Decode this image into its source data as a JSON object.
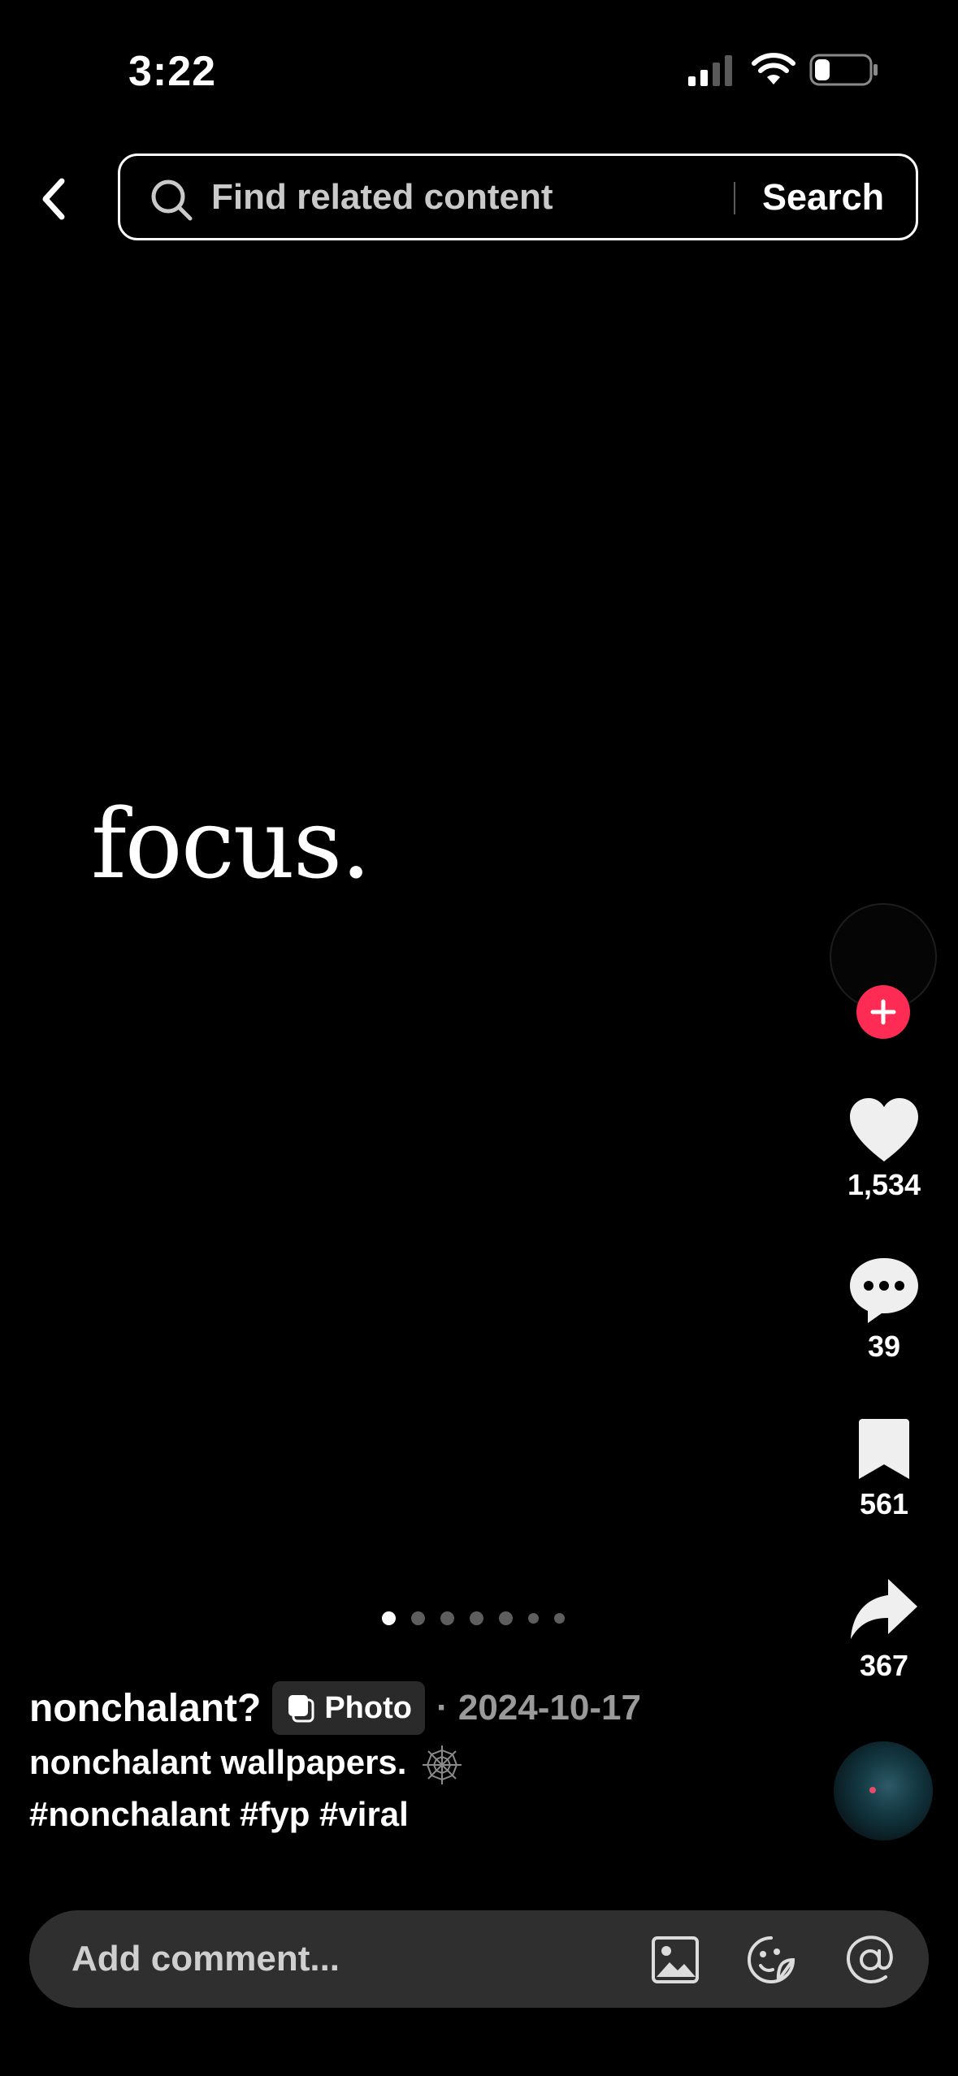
{
  "status_bar": {
    "time": "3:22",
    "icons": [
      "cell-signal-icon",
      "wifi-icon",
      "battery-icon"
    ]
  },
  "search": {
    "placeholder": "Find related content",
    "button_label": "Search",
    "icons": [
      "back-chevron-icon",
      "search-icon"
    ]
  },
  "photo": {
    "text": "focus.",
    "slide_count": 7,
    "active_slide": 1
  },
  "actions": {
    "likes": "1,534",
    "comments": "39",
    "bookmarks": "561",
    "shares": "367",
    "icons": [
      "heart-icon",
      "comment-bubble-icon",
      "bookmark-icon",
      "share-arrow-icon",
      "plus-icon"
    ]
  },
  "caption": {
    "author": "nonchalant?",
    "badge_label": "Photo",
    "date": "· 2024-10-17",
    "description": "nonchalant wallpapers.",
    "hashtags": "#nonchalant #fyp #viral"
  },
  "comment_bar": {
    "placeholder": "Add comment...",
    "icons": [
      "image-icon",
      "sticker-icon",
      "mention-icon"
    ]
  },
  "colors": {
    "background": "#000000",
    "follow_accent": "#fe2c55",
    "comment_bar_bg": "#2f2f2f",
    "date_text": "#9a9a9a"
  }
}
